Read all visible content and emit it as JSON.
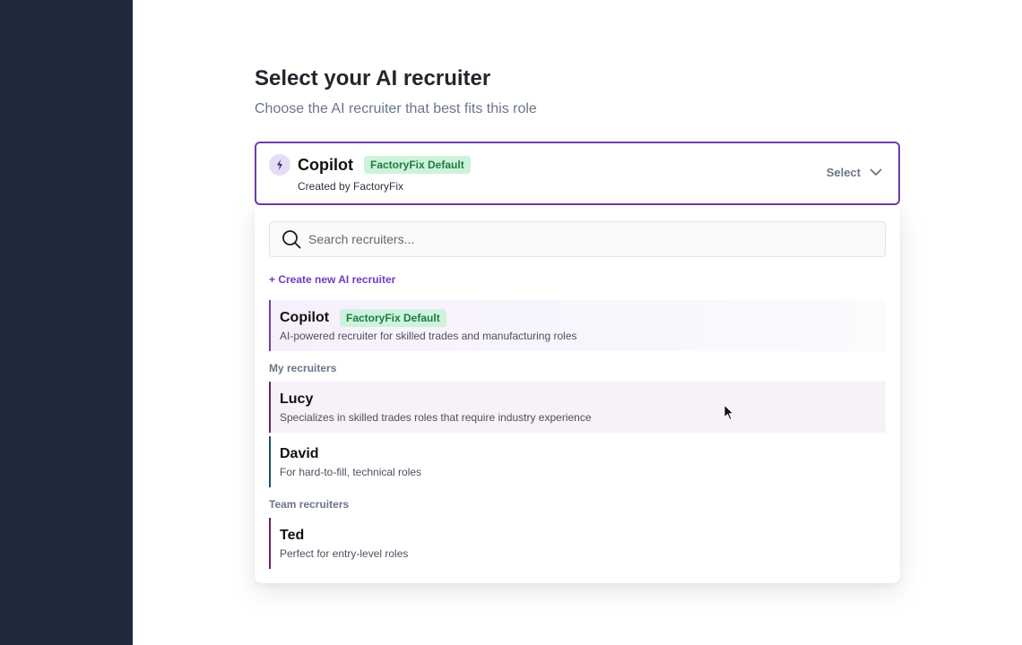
{
  "page": {
    "title": "Select your AI recruiter",
    "subtitle": "Choose the AI recruiter that best fits this role"
  },
  "selector": {
    "name": "Copilot",
    "badge": "FactoryFix Default",
    "created_by": "Created by FactoryFix",
    "action_label": "Select",
    "icon": "sparkle-bolt-icon"
  },
  "dropdown": {
    "search_placeholder": "Search recruiters...",
    "create_label": "+ Create new AI recruiter",
    "default_item": {
      "name": "Copilot",
      "badge": "FactoryFix Default",
      "description": "AI-powered recruiter for skilled trades and manufacturing roles"
    },
    "my_section_label": "My recruiters",
    "my_recruiters": [
      {
        "name": "Lucy",
        "description": "Specializes in skilled trades roles that require industry experience"
      },
      {
        "name": "David",
        "description": "For hard-to-fill, technical roles"
      }
    ],
    "team_section_label": "Team recruiters",
    "team_recruiters": [
      {
        "name": "Ted",
        "description": "Perfect for entry-level roles"
      }
    ]
  },
  "colors": {
    "sidebar": "#1f2a3c",
    "accent": "#6b3fa8",
    "badge_bg": "#cdf3dc",
    "badge_text": "#1f7a43"
  }
}
